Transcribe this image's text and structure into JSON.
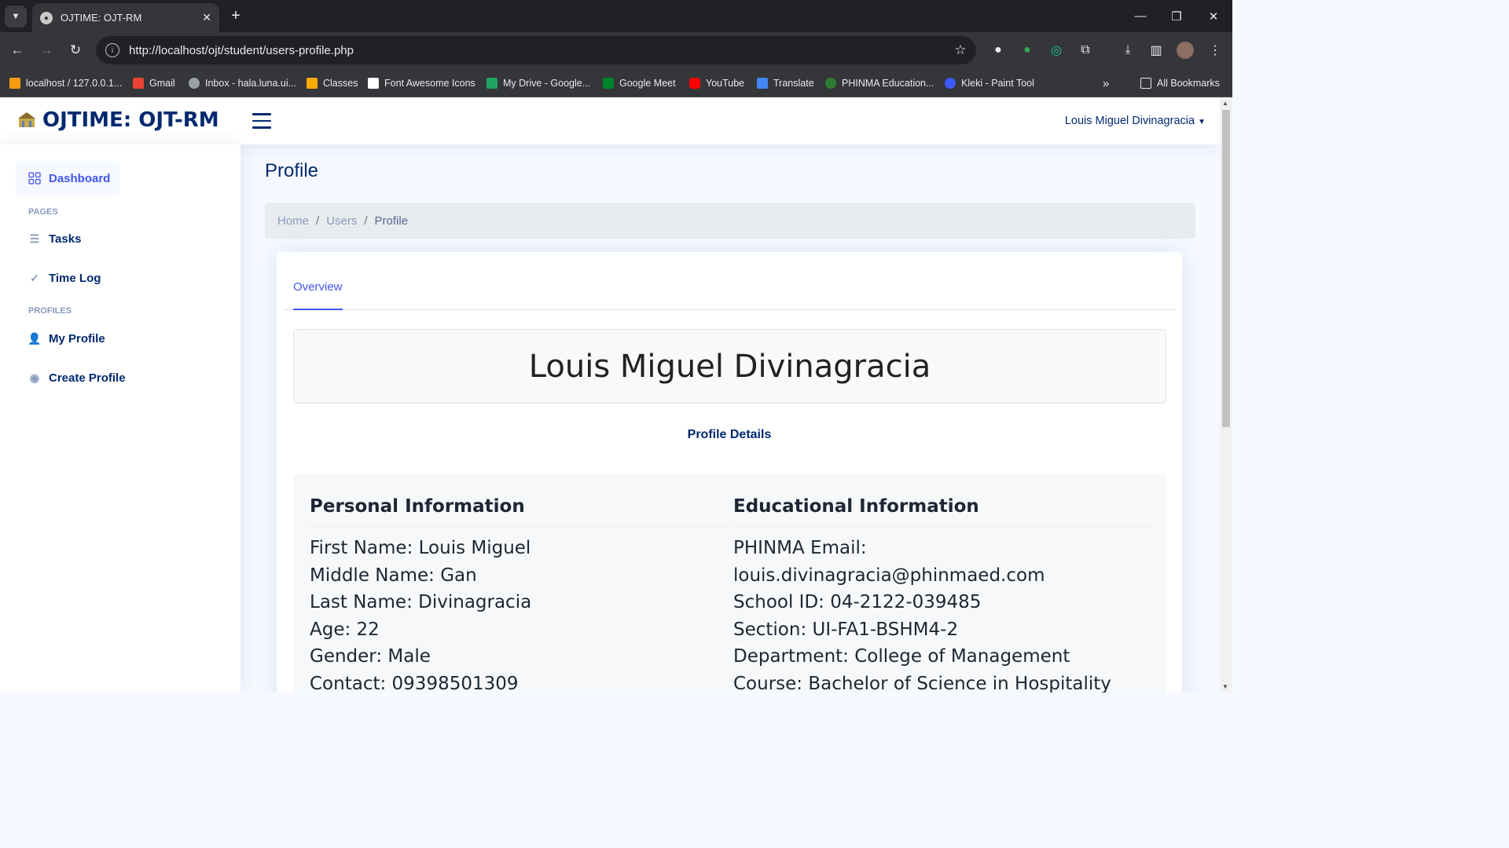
{
  "browser": {
    "tab_title": "OJTIME: OJT-RM",
    "url": "http://localhost/ojt/student/users-profile.php",
    "bookmarks": [
      {
        "label": "localhost / 127.0.0.1...",
        "color": "#f89c0e"
      },
      {
        "label": "Gmail",
        "color": "#ea4335"
      },
      {
        "label": "Inbox - hala.luna.ui...",
        "color": "#9aa0a6"
      },
      {
        "label": "Classes",
        "color": "#f9ab00"
      },
      {
        "label": "Font Awesome Icons",
        "color": "#ffffff"
      },
      {
        "label": "My Drive - Google...",
        "color": "#1fa463"
      },
      {
        "label": "Google Meet",
        "color": "#00832d"
      },
      {
        "label": "YouTube",
        "color": "#ff0000"
      },
      {
        "label": "Translate",
        "color": "#4285f4"
      },
      {
        "label": "PHINMA Education...",
        "color": "#2e7d32"
      },
      {
        "label": "Kleki - Paint Tool",
        "color": "#3d5afe"
      }
    ],
    "all_bookmarks": "All Bookmarks"
  },
  "header": {
    "logo_text": "OJTIME: OJT-RM",
    "user_name": "Louis Miguel Divinagracia"
  },
  "sidebar": {
    "dashboard": "Dashboard",
    "pages_heading": "PAGES",
    "tasks": "Tasks",
    "time_log": "Time Log",
    "profiles_heading": "PROFILES",
    "my_profile": "My Profile",
    "create_profile": "Create Profile"
  },
  "main": {
    "page_title": "Profile",
    "breadcrumb": [
      "Home",
      "Users",
      "Profile"
    ],
    "tab_overview": "Overview",
    "full_name": "Louis Miguel Divinagracia",
    "profile_details_link": "Profile Details",
    "personal": {
      "heading": "Personal Information",
      "lines": [
        "First Name: Louis Miguel",
        "Middle Name: Gan",
        "Last Name: Divinagracia",
        "Age: 22",
        "Gender: Male",
        "Contact: 09398501309"
      ]
    },
    "educational": {
      "heading": "Educational Information",
      "lines": [
        "PHINMA Email:",
        "louis.divinagracia@phinmaed.com",
        "School ID: 04-2122-039485",
        "Section: UI-FA1-BSHM4-2",
        "Department: College of Management",
        "Course: Bachelor of Science in Hospitality"
      ]
    }
  }
}
